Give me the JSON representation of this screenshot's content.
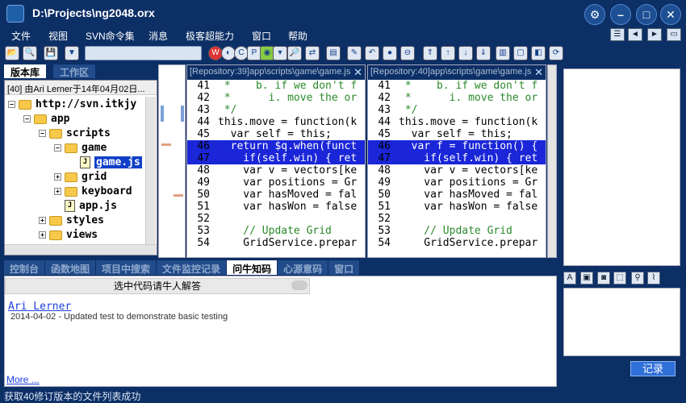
{
  "window": {
    "title": "D:\\Projects\\ng2048.orx"
  },
  "menu": [
    "文件",
    "视图",
    "SVN命令集",
    "消息",
    "极客超能力",
    "窗口",
    "帮助"
  ],
  "left_tabs": [
    "版本库",
    "工作区"
  ],
  "tree": {
    "header": "[40] 由Ari Lerner于14年04月02日...",
    "nodes": [
      {
        "label": "http://svn.itkjy",
        "level": 0,
        "type": "folder",
        "toggle": "−"
      },
      {
        "label": "app",
        "level": 1,
        "type": "folder",
        "toggle": "−"
      },
      {
        "label": "scripts",
        "level": 2,
        "type": "folder",
        "toggle": "−"
      },
      {
        "label": "game",
        "level": 3,
        "type": "folder",
        "toggle": "−"
      },
      {
        "label": "game.js",
        "level": 4,
        "type": "file",
        "selected": true
      },
      {
        "label": "grid",
        "level": 3,
        "type": "folder",
        "toggle": "+"
      },
      {
        "label": "keyboard",
        "level": 3,
        "type": "folder",
        "toggle": "+"
      },
      {
        "label": "app.js",
        "level": 3,
        "type": "file"
      },
      {
        "label": "styles",
        "level": 2,
        "type": "folder",
        "toggle": "+"
      },
      {
        "label": "views",
        "level": 2,
        "type": "folder",
        "toggle": "+"
      }
    ]
  },
  "left_pane": {
    "title": "[Repository:39]app\\scripts\\game\\game.js",
    "lines": [
      {
        "n": "41",
        "text": " *    b. if we don't f",
        "cls": "cm"
      },
      {
        "n": "42",
        "text": " *      i. move the or",
        "cls": "cm"
      },
      {
        "n": "43",
        "text": " */",
        "cls": "cm"
      },
      {
        "n": "44",
        "text": "this.move = function(k",
        "cls": ""
      },
      {
        "n": "45",
        "text": "  var self = this;",
        "cls": ""
      },
      {
        "n": "46",
        "text": "  return $q.when(funct",
        "cls": "hl"
      },
      {
        "n": "47",
        "text": "    if(self.win) { ret",
        "cls": "hl"
      },
      {
        "n": "48",
        "text": "    var v = vectors[ke",
        "cls": ""
      },
      {
        "n": "49",
        "text": "    var positions = Gr",
        "cls": ""
      },
      {
        "n": "50",
        "text": "    var hasMoved = fal",
        "cls": ""
      },
      {
        "n": "51",
        "text": "    var hasWon = false",
        "cls": ""
      },
      {
        "n": "52",
        "text": "",
        "cls": ""
      },
      {
        "n": "53",
        "text": "    // Update Grid",
        "cls": "cm"
      },
      {
        "n": "54",
        "text": "    GridService.prepar",
        "cls": ""
      }
    ]
  },
  "right_pane": {
    "title": "[Repository:40]app\\scripts\\game\\game.js",
    "lines": [
      {
        "n": "41",
        "text": " *    b. if we don't f",
        "cls": "cm"
      },
      {
        "n": "42",
        "text": " *      i. move the or",
        "cls": "cm"
      },
      {
        "n": "43",
        "text": " */",
        "cls": "cm"
      },
      {
        "n": "44",
        "text": "this.move = function(k",
        "cls": ""
      },
      {
        "n": "45",
        "text": "  var self = this;",
        "cls": ""
      },
      {
        "n": "46",
        "text": "  var f = function() {",
        "cls": "hl"
      },
      {
        "n": "47",
        "text": "    if(self.win) { ret",
        "cls": "hl"
      },
      {
        "n": "48",
        "text": "    var v = vectors[ke",
        "cls": ""
      },
      {
        "n": "49",
        "text": "    var positions = Gr",
        "cls": ""
      },
      {
        "n": "50",
        "text": "    var hasMoved = fal",
        "cls": ""
      },
      {
        "n": "51",
        "text": "    var hasWon = false",
        "cls": ""
      },
      {
        "n": "52",
        "text": "",
        "cls": ""
      },
      {
        "n": "53",
        "text": "    // Update Grid",
        "cls": "cm"
      },
      {
        "n": "54",
        "text": "    GridService.prepar",
        "cls": ""
      }
    ]
  },
  "bottom_tabs": [
    "控制台",
    "函数地图",
    "项目中搜索",
    "文件监控记录",
    "问牛知码",
    "心源意码",
    "窗口"
  ],
  "bottom_active_tab": "问牛知码",
  "panel": {
    "ask_button": "选中代码请牛人解答",
    "commit_author": "Ari Lerner",
    "commit_date": "2014-04-02",
    "commit_message": " - Updated test to demonstrate basic testing",
    "more": "More ..."
  },
  "right_panel": {
    "record_button": "记录"
  },
  "status": "获取40修订版本的文件列表成功",
  "colors": {
    "chrome": "#0c2f66",
    "highlight": "#1a26d8",
    "selected": "#1040c8"
  }
}
